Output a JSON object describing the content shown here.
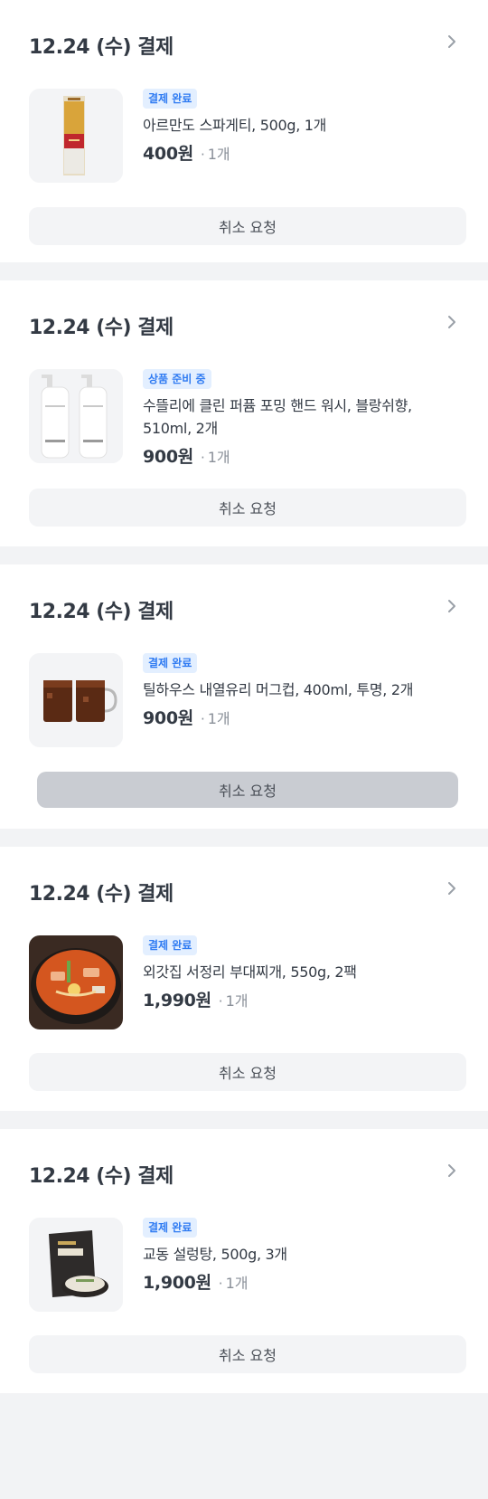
{
  "orders": [
    {
      "date": "12.24 (수) 결제",
      "status": "결제 완료",
      "product": "아르만도 스파게티, 500g, 1개",
      "price": "400원",
      "dot": "·",
      "qty": "1개",
      "cancel_label": "취소 요청",
      "thumb_icon": "spaghetti-package-image"
    },
    {
      "date": "12.24 (수) 결제",
      "status": "상품 준비 중",
      "product": "수뜰리에 클린 퍼퓸 포밍 핸드 워시, 블랑쉬향, 510ml, 2개",
      "price": "900원",
      "dot": "·",
      "qty": "1개",
      "cancel_label": "취소 요청",
      "thumb_icon": "hand-wash-bottles-image"
    },
    {
      "date": "12.24 (수) 결제",
      "status": "결제 완료",
      "product": "틸하우스 내열유리 머그컵, 400ml, 투명, 2개",
      "price": "900원",
      "dot": "·",
      "qty": "1개",
      "cancel_label": "취소 요청",
      "thumb_icon": "glass-mugs-image"
    },
    {
      "date": "12.24 (수) 결제",
      "status": "결제 완료",
      "product": "외갓집 서정리 부대찌개, 550g, 2팩",
      "price": "1,990원",
      "dot": "·",
      "qty": "1개",
      "cancel_label": "취소 요청",
      "thumb_icon": "budae-jjigae-image"
    },
    {
      "date": "12.24 (수) 결제",
      "status": "결제 완료",
      "product": "교동 설렁탕, 500g, 3개",
      "price": "1,900원",
      "dot": "·",
      "qty": "1개",
      "cancel_label": "취소 요청",
      "thumb_icon": "seolleongtang-pouch-image"
    }
  ],
  "colors": {
    "badge_bg": "#e3efff",
    "badge_text": "#2f7bf2",
    "page_bg": "#f2f3f5",
    "button_bg": "#f3f4f6",
    "button_pressed_bg": "#c9ccd2"
  }
}
